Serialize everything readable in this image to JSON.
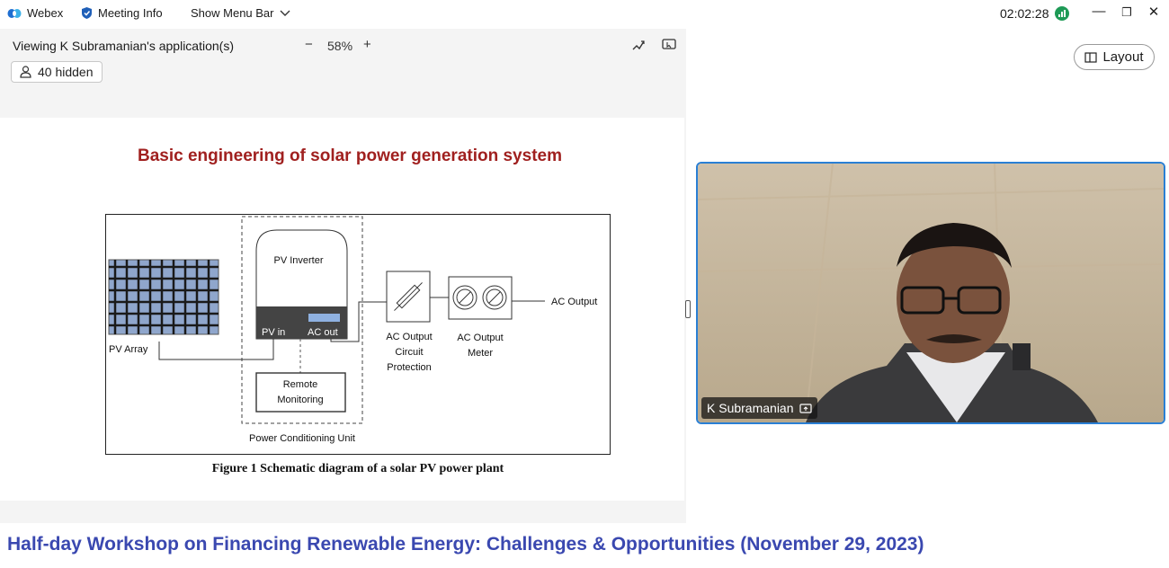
{
  "topbar": {
    "app_name": "Webex",
    "meeting_info": "Meeting Info",
    "show_menu_bar": "Show Menu Bar",
    "clock": "02:02:28"
  },
  "share": {
    "viewing_label": "Viewing K Subramanian's application(s)",
    "zoom_level": "58%",
    "hidden_count": "40 hidden"
  },
  "slide": {
    "title": "Basic engineering of solar power generation system",
    "caption": "Figure 1 Schematic diagram of a solar PV power plant",
    "labels": {
      "pv_array": "PV Array",
      "pv_inverter": "PV Inverter",
      "pv_in": "PV in",
      "ac_out": "AC out",
      "remote_1": "Remote",
      "remote_2": "Monitoring",
      "pcu": "Power Conditioning Unit",
      "prot_1": "AC Output",
      "prot_2": "Circuit",
      "prot_3": "Protection",
      "meter_1": "AC Output",
      "meter_2": "Meter",
      "ac_output": "AC Output"
    }
  },
  "layout_button": "Layout",
  "video": {
    "participant_name": "K Subramanian"
  },
  "banner": "Half-day Workshop on Financing Renewable Energy: Challenges & Opportunities (November 29, 2023)",
  "colors": {
    "title_red": "#a0201f",
    "banner_blue": "#3a48b0",
    "video_border": "#2a7fd4",
    "webex_blue": "#1f6fd1"
  }
}
